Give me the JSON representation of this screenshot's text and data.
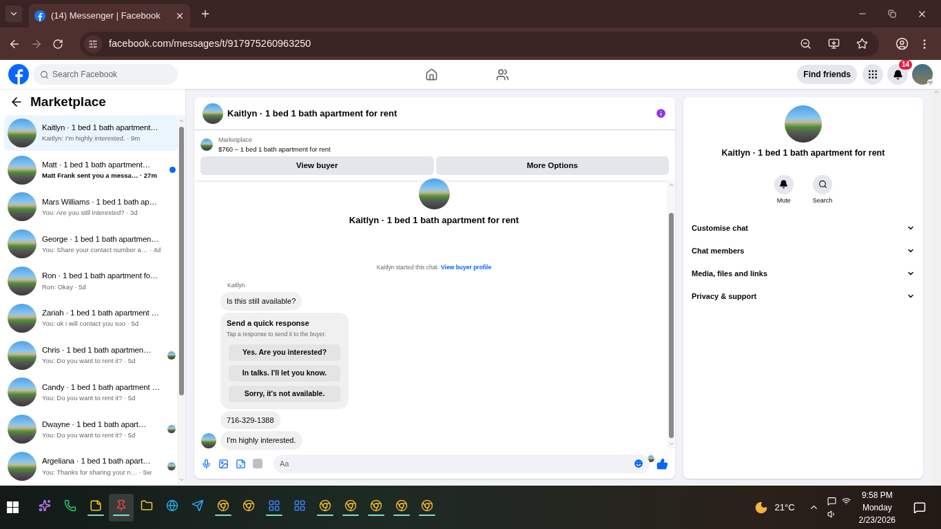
{
  "browser": {
    "tab_title": "(14) Messenger | Facebook",
    "url": "facebook.com/messages/t/917975260963250"
  },
  "header": {
    "search_placeholder": "Search Facebook",
    "find_friends": "Find friends",
    "notification_badge": "14"
  },
  "sidebar": {
    "title": "Marketplace",
    "conversations": [
      {
        "name": "Kaitlyn · 1 bed 1 bath apartment…",
        "snippet": "Kaitlyn: I'm highly interested. · 9m",
        "selected": true,
        "unread": false,
        "seen": false
      },
      {
        "name": "Matt · 1 bed 1 bath apartment…",
        "snippet": "Matt Frank sent you a messa…  · 27m",
        "selected": false,
        "unread": true,
        "seen": false
      },
      {
        "name": "Mars Williams · 1 bed 1 bath ap…",
        "snippet": "You: Are you still interested? · 3d",
        "selected": false,
        "unread": false,
        "seen": false
      },
      {
        "name": "George · 1 bed 1 bath apartmen…",
        "snippet": "You: Share your contact number a…  · 4d",
        "selected": false,
        "unread": false,
        "seen": false
      },
      {
        "name": "Ron · 1 bed 1 bath apartment fo…",
        "snippet": "Ron: Okay · 5d",
        "selected": false,
        "unread": false,
        "seen": false
      },
      {
        "name": "Zariah · 1 bed 1 bath apartment …",
        "snippet": "You: ok i will contact you soo · 5d",
        "selected": false,
        "unread": false,
        "seen": false
      },
      {
        "name": "Chris · 1 bed 1 bath apartmen…",
        "snippet": "You: Do you want to rent it? · 5d",
        "selected": false,
        "unread": false,
        "seen": true
      },
      {
        "name": "Candy · 1 bed 1 bath apartment …",
        "snippet": "You: Do you want to rent it? · 5d",
        "selected": false,
        "unread": false,
        "seen": false
      },
      {
        "name": "Dwayne · 1 bed 1 bath apart…",
        "snippet": "You: Do you want to rent it? · 5d",
        "selected": false,
        "unread": false,
        "seen": true
      },
      {
        "name": "Argeliana · 1 bed 1 bath apart…",
        "snippet": "You: Thanks for sharing your n…  · 5w",
        "selected": false,
        "unread": false,
        "seen": true
      }
    ]
  },
  "chat": {
    "title": "Kaitlyn · 1 bed 1 bath apartment for rent",
    "listing_label": "Marketplace",
    "listing_text": "$760 – 1 bed 1 bath apartment for rent",
    "buttons": [
      "View buyer",
      "More Options"
    ],
    "intro_title": "Kaitlyn · 1 bed 1 bath apartment for rent",
    "started_text": "Kaitlyn started this chat.",
    "started_link": "View buyer profile",
    "sender": "Kaitlyn",
    "messages": [
      {
        "kind": "bubble",
        "text": "Is this still available?",
        "avatar": false
      },
      {
        "kind": "quick",
        "title": "Send a quick response",
        "subtitle": "Tap a response to send it to the buyer.",
        "options": [
          "Yes. Are you interested?",
          "In talks. I'll let you know.",
          "Sorry, it's not available."
        ]
      },
      {
        "kind": "bubble",
        "text": "716-329-1388",
        "avatar": false
      },
      {
        "kind": "bubble",
        "text": "I'm highly interested.",
        "avatar": true
      }
    ],
    "composer_placeholder": "Aa"
  },
  "info": {
    "title": "Kaitlyn · 1 bed 1 bath apartment for rent",
    "actions": [
      {
        "kind": "bell",
        "label": "Mute"
      },
      {
        "kind": "search",
        "label": "Search"
      }
    ],
    "sections": [
      "Customise chat",
      "Chat members",
      "Media, files and links",
      "Privacy & support"
    ]
  },
  "taskbar": {
    "apps": [
      {
        "kind": "copilot",
        "open": false,
        "active": false
      },
      {
        "kind": "chat",
        "open": false,
        "active": false
      },
      {
        "kind": "notes",
        "open": true,
        "active": false
      },
      {
        "kind": "pin",
        "open": true,
        "active": true
      },
      {
        "kind": "folder",
        "open": false,
        "active": false
      },
      {
        "kind": "edge",
        "open": false,
        "active": false
      },
      {
        "kind": "telegram",
        "open": false,
        "active": false
      },
      {
        "kind": "browser",
        "open": true,
        "active": false
      },
      {
        "kind": "browser",
        "open": false,
        "active": false
      },
      {
        "kind": "tiles",
        "open": true,
        "active": false
      },
      {
        "kind": "tiles",
        "open": false,
        "active": false
      },
      {
        "kind": "browser",
        "open": true,
        "active": false
      },
      {
        "kind": "browser",
        "open": true,
        "active": false
      },
      {
        "kind": "browser",
        "open": true,
        "active": false
      },
      {
        "kind": "browser",
        "open": true,
        "active": false
      },
      {
        "kind": "browser",
        "open": true,
        "active": false
      }
    ],
    "temperature": "21°C",
    "time": "9:58 PM",
    "day": "Monday",
    "date": "2/23/2026"
  }
}
